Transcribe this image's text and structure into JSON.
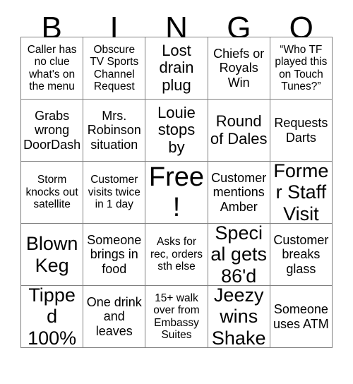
{
  "header": {
    "letters": [
      "B",
      "I",
      "N",
      "G",
      "O"
    ]
  },
  "grid": {
    "columns": 5,
    "rows": 5,
    "free_space_index": 12,
    "border_color": "#808080",
    "text_color": "#000000",
    "background_color": "#ffffff",
    "cells": [
      {
        "text": "Caller has no clue what's on the menu",
        "size": "sm"
      },
      {
        "text": "Obscure TV Sports Channel Request",
        "size": "sm"
      },
      {
        "text": "Lost drain plug",
        "size": "lg"
      },
      {
        "text": "Chiefs or Royals Win",
        "size": "md"
      },
      {
        "text": "“Who TF played this on Touch Tunes?”",
        "size": "sm"
      },
      {
        "text": "Grabs wrong DoorDash",
        "size": "md"
      },
      {
        "text": "Mrs. Robinson situation",
        "size": "md"
      },
      {
        "text": "Louie stops by",
        "size": "lg"
      },
      {
        "text": "Round of Dales",
        "size": "lg"
      },
      {
        "text": "Requests Darts",
        "size": "md"
      },
      {
        "text": "Storm knocks out satellite",
        "size": "sm"
      },
      {
        "text": "Customer visits twice in 1 day",
        "size": "sm"
      },
      {
        "text": "Free!",
        "size": "xxl"
      },
      {
        "text": "Customer mentions Amber",
        "size": "md"
      },
      {
        "text": "Former Staff Visit",
        "size": "xl"
      },
      {
        "text": "Blown Keg",
        "size": "xl"
      },
      {
        "text": "Someone brings in food",
        "size": "md"
      },
      {
        "text": "Asks for rec, orders sth else",
        "size": "sm"
      },
      {
        "text": "Special gets 86'd",
        "size": "xl"
      },
      {
        "text": "Customer breaks glass",
        "size": "md"
      },
      {
        "text": "Tipped 100%",
        "size": "xl"
      },
      {
        "text": "One drink and leaves",
        "size": "md"
      },
      {
        "text": "15+ walk over from Embassy Suites",
        "size": "sm"
      },
      {
        "text": "Jeezy wins Shake",
        "size": "xl"
      },
      {
        "text": "Someone uses ATM",
        "size": "md"
      }
    ]
  }
}
